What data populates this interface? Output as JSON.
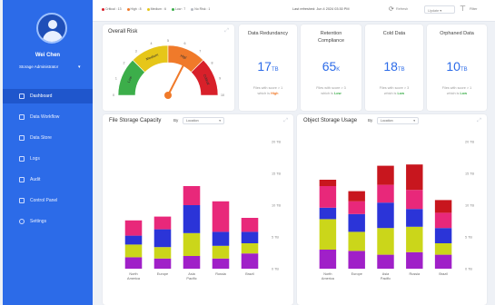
{
  "sidebar": {
    "user_name": "Wei Chen",
    "role": "Storage Administrator",
    "items": [
      {
        "label": "Dashboard",
        "active": true
      },
      {
        "label": "Data Workflow",
        "active": false
      },
      {
        "label": "Data Store",
        "active": false
      },
      {
        "label": "Logs",
        "active": false
      },
      {
        "label": "Audit",
        "active": false
      },
      {
        "label": "Control Panel",
        "active": false
      },
      {
        "label": "Settings",
        "active": false
      }
    ]
  },
  "topbar": {
    "legend": [
      {
        "label": "Critical",
        "value": "13",
        "color": "#d8202a"
      },
      {
        "label": "High",
        "value": "8",
        "color": "#f07a2a"
      },
      {
        "label": "Medium",
        "value": "6",
        "color": "#e6c619"
      },
      {
        "label": "Low",
        "value": "7",
        "color": "#3cae4a"
      },
      {
        "label": "No Risk",
        "value": "1",
        "color": "#b5b9c2"
      }
    ],
    "last_refresh": "Last refreshed: Jun 4 2024 03:30 PM",
    "refresh_label": "Refresh",
    "update_select": "Update",
    "filter_label": "Filter"
  },
  "risk": {
    "title": "Overall Risk",
    "scale": [
      "0",
      "1",
      "2",
      "3",
      "4",
      "5",
      "6",
      "7",
      "8",
      "9",
      "10"
    ],
    "segments": [
      {
        "label": "Low",
        "color": "#3cae4a"
      },
      {
        "label": "Medium",
        "color": "#e6c619"
      },
      {
        "label": "High",
        "color": "#f07a2a"
      },
      {
        "label": "Critical",
        "color": "#d8202a"
      }
    ],
    "value": 6.5
  },
  "metrics": [
    {
      "title": "Data Redundancy",
      "value": "17",
      "unit": "TB",
      "sub1": "Files with score > 1",
      "sub2": "which is",
      "tag": "High",
      "tag_color": "#f07a2a"
    },
    {
      "title": "Retention Compliance",
      "value": "65",
      "unit": "K",
      "sub1": "Files with score > 3",
      "sub2": "which is",
      "tag": "Low",
      "tag_color": "#3cae4a"
    },
    {
      "title": "Cold Data",
      "value": "18",
      "unit": "TB",
      "sub1": "Files with score > 3",
      "sub2": "which is",
      "tag": "Low",
      "tag_color": "#3cae4a"
    },
    {
      "title": "Orphaned Data",
      "value": "10",
      "unit": "TB",
      "sub1": "Files with score > 1",
      "sub2": "which is",
      "tag": "Low",
      "tag_color": "#3cae4a"
    }
  ],
  "charts": {
    "file": {
      "title": "File Storage Capacity",
      "by": "By",
      "select": "Location"
    },
    "object": {
      "title": "Object Storage Usage",
      "by": "By",
      "select": "Location"
    }
  },
  "chart_data": [
    {
      "type": "bar",
      "stacked": true,
      "title": "File Storage Capacity",
      "categories": [
        "North America",
        "Europe",
        "Asia Pacific",
        "Russia",
        "Brazil"
      ],
      "y_ticks": [
        "0 TB",
        "5 TB",
        "10 TB",
        "15 TB",
        "20 TB"
      ],
      "ylim": [
        0,
        20
      ],
      "series": [
        {
          "color": "#a020c8",
          "values": [
            1.8,
            1.6,
            2.0,
            1.6,
            2.4
          ]
        },
        {
          "color": "#cbd61a",
          "values": [
            2.0,
            1.8,
            3.6,
            2.0,
            1.6
          ]
        },
        {
          "color": "#2b34d8",
          "values": [
            1.4,
            2.8,
            4.4,
            2.2,
            1.8
          ]
        },
        {
          "color": "#e8287a",
          "values": [
            2.4,
            2.0,
            3.0,
            4.8,
            2.2
          ]
        }
      ]
    },
    {
      "type": "bar",
      "stacked": true,
      "title": "Object Storage Usage",
      "categories": [
        "North America",
        "Europe",
        "Asia Pacific",
        "Russia",
        "Brazil"
      ],
      "y_ticks": [
        "0 TB",
        "5 TB",
        "10 TB",
        "15 TB",
        "20 TB"
      ],
      "ylim": [
        0,
        20
      ],
      "series": [
        {
          "color": "#a020c8",
          "values": [
            3.0,
            2.8,
            2.2,
            2.6,
            2.2
          ]
        },
        {
          "color": "#cbd61a",
          "values": [
            4.8,
            3.0,
            4.2,
            4.0,
            1.8
          ]
        },
        {
          "color": "#2b34d8",
          "values": [
            1.8,
            2.8,
            4.0,
            2.8,
            2.4
          ]
        },
        {
          "color": "#e8287a",
          "values": [
            3.4,
            2.0,
            2.8,
            3.0,
            2.4
          ]
        },
        {
          "color": "#c8161e",
          "values": [
            1.0,
            1.6,
            3.0,
            4.0,
            2.0
          ]
        }
      ]
    }
  ]
}
